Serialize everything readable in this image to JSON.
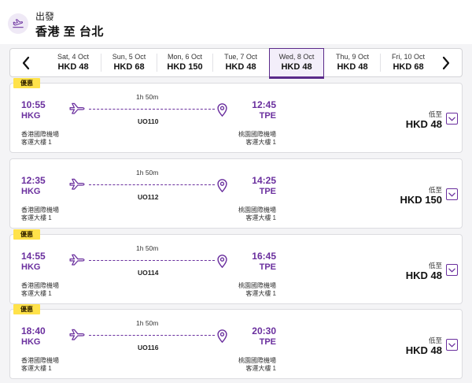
{
  "header": {
    "label": "出發",
    "route": "香港 至 台北"
  },
  "dates": [
    {
      "date": "Sat, 4 Oct",
      "price": "HKD 48"
    },
    {
      "date": "Sun, 5 Oct",
      "price": "HKD 68"
    },
    {
      "date": "Mon, 6 Oct",
      "price": "HKD 150"
    },
    {
      "date": "Tue, 7 Oct",
      "price": "HKD 48"
    },
    {
      "date": "Wed, 8 Oct",
      "price": "HKD 48",
      "selected": true
    },
    {
      "date": "Thu, 9 Oct",
      "price": "HKD 48"
    },
    {
      "date": "Fri, 10 Oct",
      "price": "HKD 68"
    }
  ],
  "flights": [
    {
      "badge": "優惠",
      "dep_time": "10:55",
      "dep_code": "HKG",
      "dep_airport": "香港國際機場",
      "dep_terminal": "客運大樓 1",
      "duration": "1h 50m",
      "flight_no": "UO110",
      "arr_time": "12:45",
      "arr_code": "TPE",
      "arr_airport": "桃園國際機場",
      "arr_terminal": "客運大樓 1",
      "low_label": "低至",
      "price": "HKD 48"
    },
    {
      "badge": "",
      "dep_time": "12:35",
      "dep_code": "HKG",
      "dep_airport": "香港國際機場",
      "dep_terminal": "客運大樓 1",
      "duration": "1h 50m",
      "flight_no": "UO112",
      "arr_time": "14:25",
      "arr_code": "TPE",
      "arr_airport": "桃園國際機場",
      "arr_terminal": "客運大樓 1",
      "low_label": "低至",
      "price": "HKD 150"
    },
    {
      "badge": "優惠",
      "dep_time": "14:55",
      "dep_code": "HKG",
      "dep_airport": "香港國際機場",
      "dep_terminal": "客運大樓 1",
      "duration": "1h 50m",
      "flight_no": "UO114",
      "arr_time": "16:45",
      "arr_code": "TPE",
      "arr_airport": "桃園國際機場",
      "arr_terminal": "客運大樓 1",
      "low_label": "低至",
      "price": "HKD 48"
    },
    {
      "badge": "優惠",
      "dep_time": "18:40",
      "dep_code": "HKG",
      "dep_airport": "香港國際機場",
      "dep_terminal": "客運大樓 1",
      "duration": "1h 50m",
      "flight_no": "UO116",
      "arr_time": "20:30",
      "arr_code": "TPE",
      "arr_airport": "桃園國際機場",
      "arr_terminal": "客運大樓 1",
      "low_label": "低至",
      "price": "HKD 48"
    }
  ],
  "icons": {
    "accent": "#6a2f9e",
    "badge_color": "#ffe24a"
  }
}
